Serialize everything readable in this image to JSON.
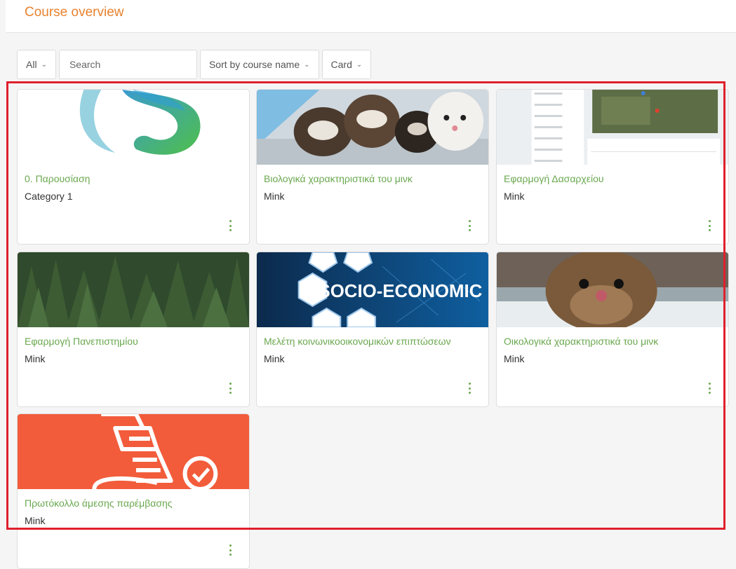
{
  "header": {
    "title": "Course overview"
  },
  "controls": {
    "filter_label": "All",
    "search_placeholder": "Search",
    "sort_label": "Sort by course name",
    "view_label": "Card"
  },
  "courses": [
    {
      "title": "0. Παρουσίαση",
      "category": "Category 1"
    },
    {
      "title": "Βιολογικά χαρακτηριστικά του μινκ",
      "category": "Mink"
    },
    {
      "title": "Εφαρμογή Δασαρχείου",
      "category": "Mink"
    },
    {
      "title": "Εφαρμογή Πανεπιστημίου",
      "category": "Mink"
    },
    {
      "title": "Μελέτη κοινωνικοοικονομικών επιπτώσεων",
      "category": "Mink",
      "image_text": "SOCIO-ECONOMIC"
    },
    {
      "title": "Οικολογικά χαρακτηριστικά του μινκ",
      "category": "Mink"
    },
    {
      "title": "Πρωτόκολλο άμεσης παρέμβασης",
      "category": "Mink"
    }
  ],
  "colors": {
    "accent": "#e8822e",
    "course_title": "#6aa84f",
    "highlight_border": "#e0202c"
  }
}
